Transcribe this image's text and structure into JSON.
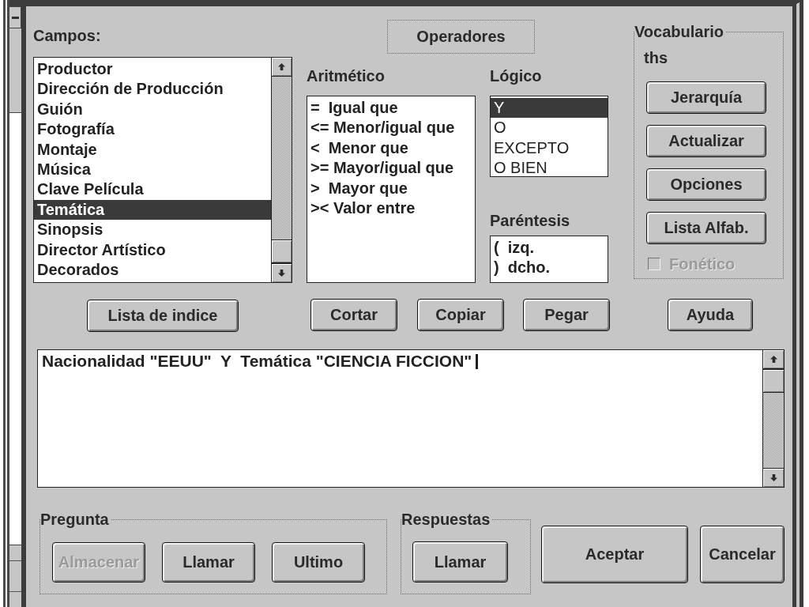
{
  "fields": {
    "label": "Campos:",
    "items": [
      {
        "label": "Productor",
        "selected": false
      },
      {
        "label": "Dirección de Producción",
        "selected": false
      },
      {
        "label": "Guión",
        "selected": false
      },
      {
        "label": "Fotografía",
        "selected": false
      },
      {
        "label": "Montaje",
        "selected": false
      },
      {
        "label": "Música",
        "selected": false
      },
      {
        "label": "Clave Película",
        "selected": false
      },
      {
        "label": "Temática",
        "selected": true
      },
      {
        "label": "Sinopsis",
        "selected": false
      },
      {
        "label": "Director Artístico",
        "selected": false
      },
      {
        "label": "Decorados",
        "selected": false
      }
    ]
  },
  "operators": {
    "title": "Operadores",
    "arithmetic": {
      "label": "Aritmético",
      "items": [
        {
          "label": "=  Igual que",
          "selected": false
        },
        {
          "label": "<= Menor/igual que",
          "selected": false
        },
        {
          "label": "<  Menor que",
          "selected": false
        },
        {
          "label": ">= Mayor/igual que",
          "selected": false
        },
        {
          "label": ">  Mayor que",
          "selected": false
        },
        {
          "label": ">< Valor entre",
          "selected": false
        }
      ]
    },
    "logical": {
      "label": "Lógico",
      "items": [
        {
          "label": "Y",
          "selected": true
        },
        {
          "label": "O",
          "selected": false
        },
        {
          "label": "EXCEPTO",
          "selected": false
        },
        {
          "label": "O BIEN",
          "selected": false
        }
      ]
    },
    "parentheses": {
      "label": "Paréntesis",
      "items": [
        {
          "label": "(  izq.",
          "selected": false
        },
        {
          "label": ")  dcho.",
          "selected": false
        }
      ]
    }
  },
  "vocabulary": {
    "title": "Vocabulario",
    "thesaurus": "ths",
    "buttons": [
      {
        "label": "Jerarquía"
      },
      {
        "label": "Actualizar"
      },
      {
        "label": "Opciones"
      },
      {
        "label": "Lista Alfab."
      }
    ],
    "phonetic": {
      "label": "Fonético",
      "checked": false,
      "disabled": true
    }
  },
  "edit_buttons": [
    {
      "label": "Lista de indice"
    },
    {
      "label": "Cortar"
    },
    {
      "label": "Copiar"
    },
    {
      "label": "Pegar"
    },
    {
      "label": "Ayuda"
    }
  ],
  "expression": {
    "value": "Nacionalidad \"EEUU\"  Y  Temática \"CIENCIA FICCION\"",
    "focused": true
  },
  "question": {
    "title": "Pregunta",
    "buttons": [
      {
        "label": "Almacenar",
        "disabled": true
      },
      {
        "label": "Llamar",
        "disabled": false
      },
      {
        "label": "Ultimo",
        "disabled": false
      }
    ]
  },
  "answers": {
    "title": "Respuestas",
    "buttons": [
      {
        "label": "Llamar"
      }
    ]
  },
  "dialog_buttons": [
    {
      "label": "Aceptar"
    },
    {
      "label": "Cancelar"
    }
  ]
}
